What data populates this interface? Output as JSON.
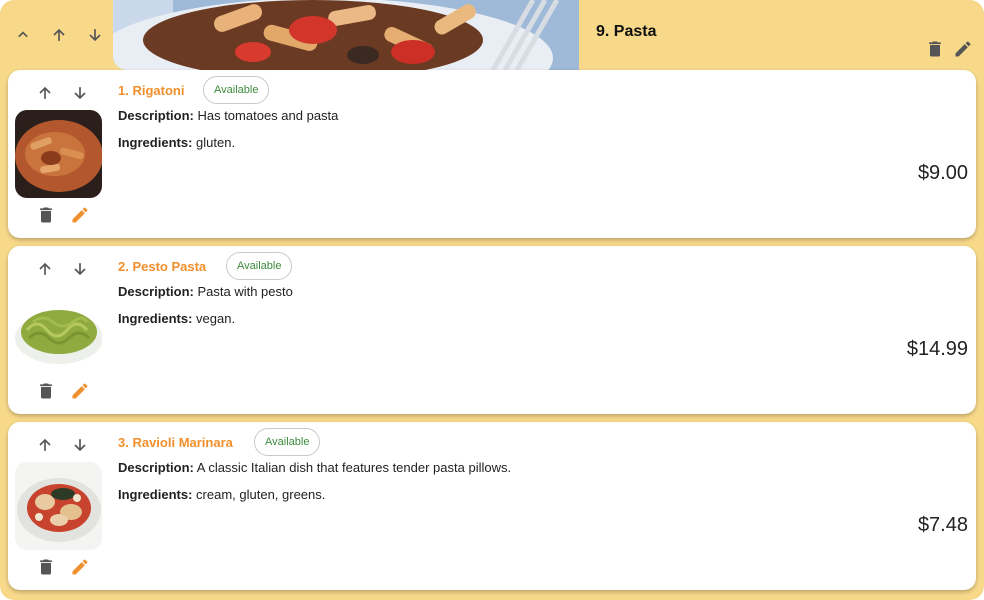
{
  "category": {
    "title": "9. Pasta",
    "image": "pasta-dish-photo"
  },
  "items": [
    {
      "name": "1. Rigatoni",
      "status": "Available",
      "description_label": "Description:",
      "description": "Has tomatoes and pasta",
      "ingredients_label": "Ingredients:",
      "ingredients": "gluten.",
      "price": "$9.00"
    },
    {
      "name": "2. Pesto Pasta",
      "status": "Available",
      "description_label": "Description:",
      "description": "Pasta with pesto",
      "ingredients_label": "Ingredients:",
      "ingredients": "vegan.",
      "price": "$14.99"
    },
    {
      "name": "3. Ravioli Marinara",
      "status": "Available",
      "description_label": "Description:",
      "description": "A classic Italian dish that features tender pasta pillows.",
      "ingredients_label": "Ingredients:",
      "ingredients": "cream, gluten, greens.",
      "price": "$7.48"
    }
  ],
  "colors": {
    "category_bg": "#f8d98a",
    "accent": "#f0902c",
    "available": "#3d8b3d",
    "icon_gray": "#555555"
  },
  "icons": [
    "chevron-up-icon",
    "arrow-up-icon",
    "arrow-down-icon",
    "trash-icon",
    "pencil-icon"
  ]
}
